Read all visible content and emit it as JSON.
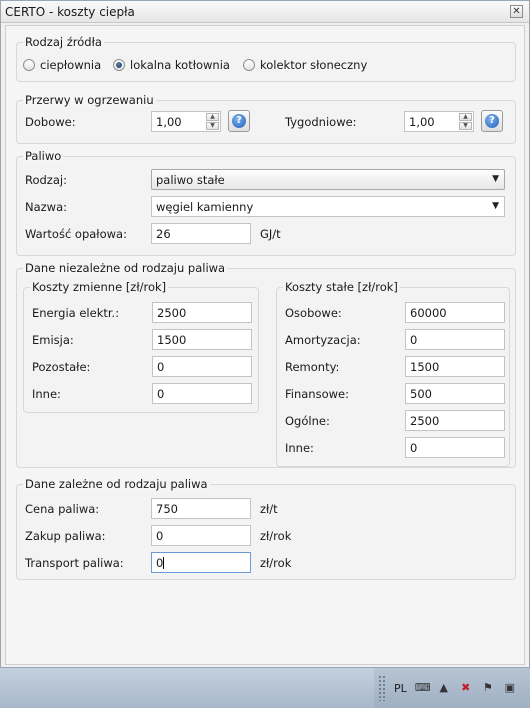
{
  "window": {
    "title": "CERTO - koszty ciepła",
    "close_glyph": "✕"
  },
  "source": {
    "title": "Rodzaj źródła",
    "options": [
      "ciepłownia",
      "lokalna kotłownia",
      "kolektor słoneczny"
    ],
    "selected": "lokalna kotłownia"
  },
  "breaks": {
    "title": "Przerwy w ogrzewaniu",
    "daily_label": "Dobowe:",
    "daily_value": "1,00",
    "weekly_label": "Tygodniowe:",
    "weekly_value": "1,00",
    "help_glyph": "?"
  },
  "fuel": {
    "title": "Paliwo",
    "type_label": "Rodzaj:",
    "type_value": "paliwo stałe",
    "name_label": "Nazwa:",
    "name_value": "węgiel kamienny",
    "calorific_label": "Wartość opałowa:",
    "calorific_value": "26",
    "calorific_unit": "GJ/t"
  },
  "independent": {
    "title": "Dane niezależne od rodzaju paliwa",
    "variable": {
      "title": "Koszty zmienne [zł/rok]",
      "rows": [
        {
          "label": "Energia elektr.:",
          "value": "2500"
        },
        {
          "label": "Emisja:",
          "value": "1500"
        },
        {
          "label": "Pozostałe:",
          "value": "0"
        },
        {
          "label": "Inne:",
          "value": "0"
        }
      ]
    },
    "fixed": {
      "title": "Koszty stałe [zł/rok]",
      "rows": [
        {
          "label": "Osobowe:",
          "value": "60000"
        },
        {
          "label": "Amortyzacja:",
          "value": "0"
        },
        {
          "label": "Remonty:",
          "value": "1500"
        },
        {
          "label": "Finansowe:",
          "value": "500"
        },
        {
          "label": "Ogólne:",
          "value": "2500"
        },
        {
          "label": "Inne:",
          "value": "0"
        }
      ]
    }
  },
  "dependent": {
    "title": "Dane zależne od rodzaju paliwa",
    "rows": [
      {
        "label": "Cena paliwa:",
        "value": "750",
        "unit": "zł/t"
      },
      {
        "label": "Zakup paliwa:",
        "value": "0",
        "unit": "zł/rok"
      },
      {
        "label": "Transport paliwa:",
        "value": "0",
        "unit": "zł/rok"
      }
    ]
  },
  "taskbar": {
    "language": "PL",
    "icons": [
      "keyboard-icon",
      "tray-up-arrow-icon",
      "network-warning-icon",
      "action-center-flag-icon",
      "safely-remove-icon"
    ]
  }
}
